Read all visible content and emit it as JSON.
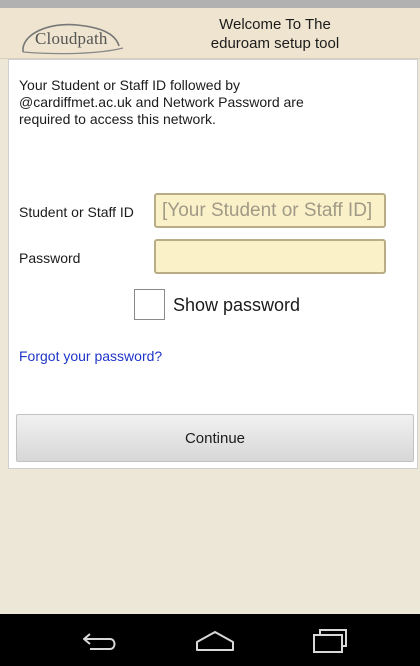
{
  "header": {
    "logo_text": "Cloudpath",
    "title_line1": "Welcome To The",
    "title_line2": "eduroam setup tool"
  },
  "form": {
    "intro_line1": "Your Student or Staff ID followed by",
    "intro_line2": "@cardiffmet.ac.uk and Network Password are",
    "intro_line3": "required to access this network.",
    "username_label": "Student or Staff ID",
    "username_placeholder": "[Your Student or Staff ID]",
    "username_value": "",
    "password_label": "Password",
    "password_value": "",
    "show_password_label": "Show password",
    "show_password_checked": false,
    "forgot_link": "Forgot your password?",
    "continue_label": "Continue"
  },
  "navbar": {
    "icons": [
      "back-icon",
      "home-icon",
      "recent-apps-icon"
    ]
  },
  "colors": {
    "header_bg": "#eee4cf",
    "field_bg": "#fbf1c9",
    "link": "#1f35c8",
    "navbar_bg": "#000000"
  }
}
